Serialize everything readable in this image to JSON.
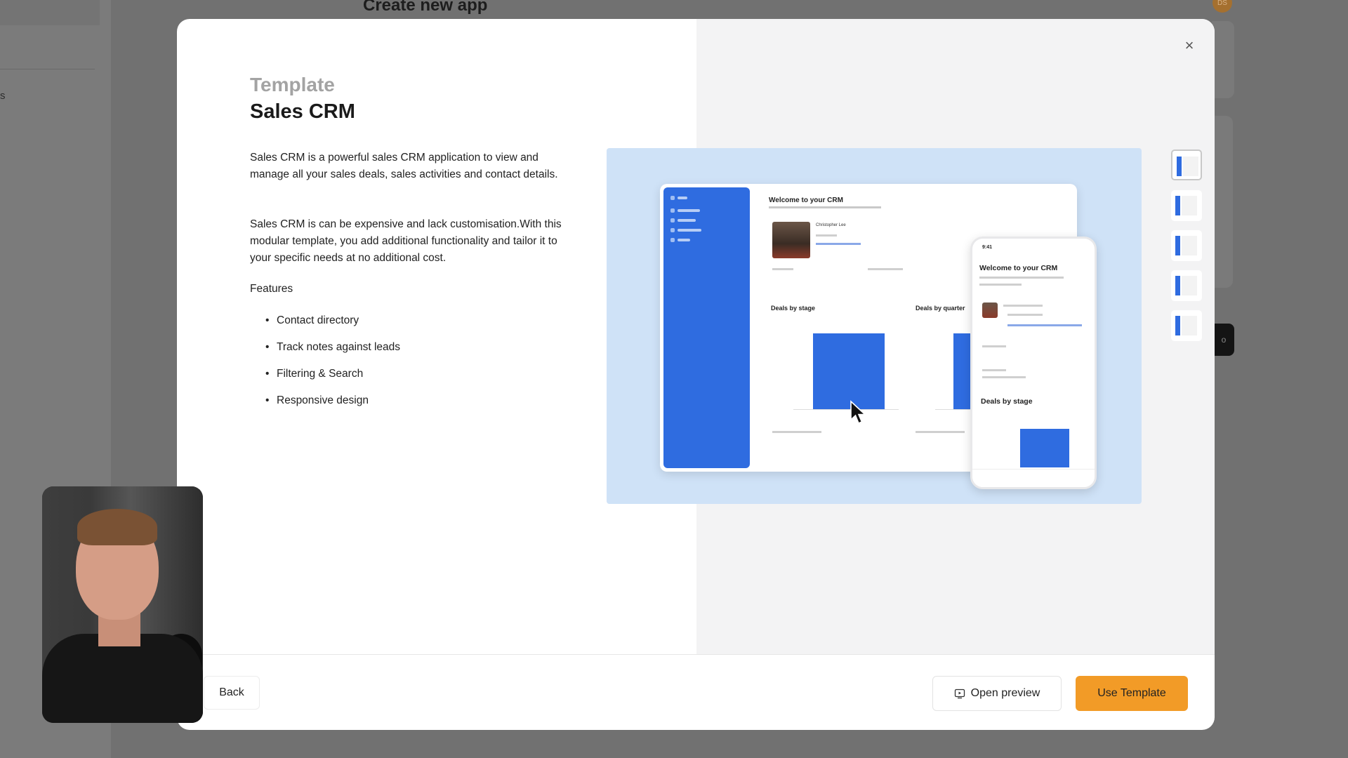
{
  "background": {
    "page_title": "Create new app",
    "avatar_initials": "DS",
    "sidebar_fragment": "s",
    "dark_button_fragment": "o"
  },
  "modal": {
    "eyebrow": "Template",
    "title": "Sales CRM",
    "description_1": "Sales CRM is a powerful sales CRM application to view and manage all your sales deals, sales activities and contact details.",
    "description_2": "Sales CRM is can be expensive and lack customisation.With this modular template, you add additional functionality and tailor it to your specific needs at no additional cost.",
    "features_label": "Features",
    "features": [
      "Contact directory",
      "Track notes against leads",
      "Filtering & Search",
      "Responsive design"
    ],
    "close_icon": "×",
    "preview": {
      "desktop_welcome": "Welcome to your CRM",
      "desktop_name": "Christopher Lee",
      "desktop_deals_by_stage": "Deals by stage",
      "desktop_deals_by_quarter": "Deals by quarter",
      "phone_time": "9:41",
      "phone_welcome": "Welcome to your CRM",
      "phone_deals_by_stage": "Deals by stage"
    },
    "thumbnails_count": 5
  },
  "footer": {
    "back_label": "Back",
    "open_preview_label": "Open preview",
    "use_template_label": "Use Template"
  },
  "colors": {
    "accent": "#f29b27",
    "brand_blue": "#2f6ce0",
    "preview_bg": "#cfe2f7"
  }
}
